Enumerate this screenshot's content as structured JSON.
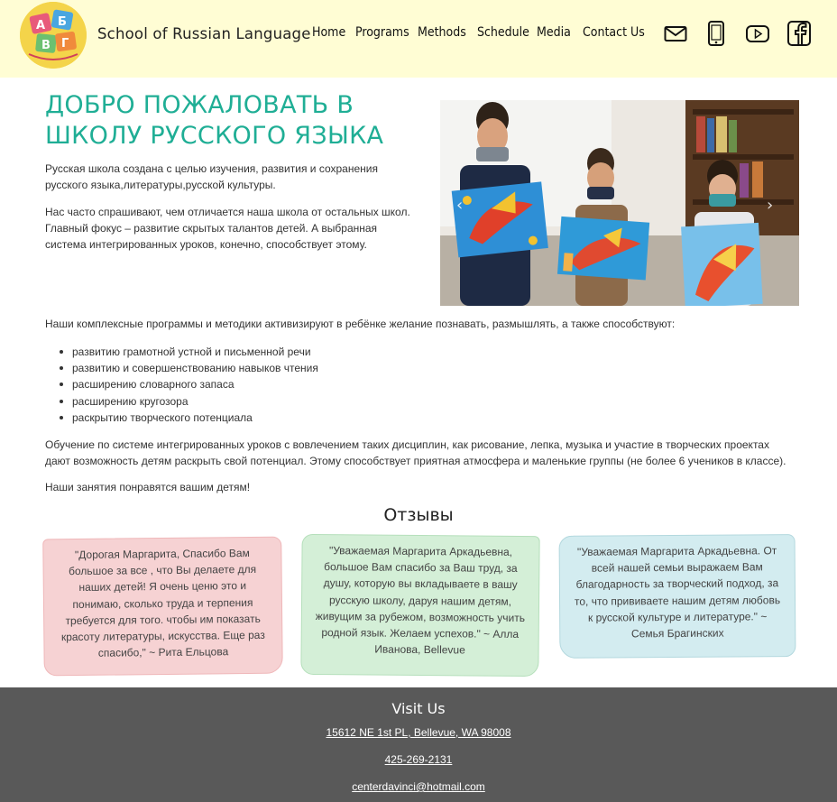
{
  "header": {
    "brand": "School of Russian Language",
    "nav": [
      "Home",
      "Programs",
      "Methods",
      "Schedule",
      "Media",
      "Contact Us"
    ],
    "icons": [
      "mail-icon",
      "phone-icon",
      "youtube-icon",
      "facebook-icon"
    ],
    "logo_letters": [
      "А",
      "Б",
      "В",
      "Г"
    ]
  },
  "main": {
    "title": "ДОБРО ПОЖАЛОВАТЬ В ШКОЛУ РУССКОГО ЯЗЫКА",
    "intro_1": "Русская школа создана с целью изучения, развития и сохранения русского языка,литературы,русской культуры.",
    "intro_2": "Нас часто спрашивают, чем отличается наша школа от остальных школ. Главный фокус – развитие скрытых талантов детей. А выбранная система интегрированных уроков, конечно, способствует этому.",
    "programs_lead": "Наши комплексные программы и методики активизируют в ребёнке желание познавать, размышлять, а также способствуют:",
    "bullets": [
      "развитию грамотной устной и письменной речи",
      "развитию и совершенствованию навыков чтения",
      "расширению словарного запаса",
      "расширению кругозора",
      "раскрытию творческого потенциала"
    ],
    "integrated": "Обучение по системе интегрированных уроков с вовлечением таких дисциплин, как рисование, лепка, музыка и участие в творческих проектах дают возможность детям раскрыть свой потенциал. Этому способствует приятная атмосфера и маленькие группы (не более 6 учеников в классе).",
    "closing": "Наши занятия понравятся вашим детям!",
    "carousel": {
      "prev": "‹",
      "next": "›"
    }
  },
  "reviews": {
    "title": "Отзывы",
    "items": [
      "\"Дорогая Маргарита, Спасибо Вам большое за все , что Вы делаете для наших детей! Я очень ценю это и понимаю, сколько труда и терпения требуется для того. чтобы им показать красоту литературы, искусства. Еще раз спасибо,\" ~ Рита Ельцова",
      "\"Уважаемая Маргарита Аркадьевна, большое Вам спасибо за Ваш труд, за душу, которую вы вкладываете в вашу русскую школу, даруя нашим детям, живущим за рубежом, возможность учить родной язык. Желаем успехов.\" ~ Алла Иванова, Bellevue",
      "\"Уважаемая Маргарита Аркадьевна. От всей нашей семьи выражаем Вам благодарность за творческий подход, за то, что прививаете нашим детям любовь к русской культуре и литературе.\" ~ Семья Брагинских"
    ]
  },
  "footer": {
    "title": "Visit Us",
    "address": "15612 NE 1st PL, Bellevue, WA 98008",
    "phone": "425-269-2131",
    "email": "centerdavinci@hotmail.com"
  },
  "colors": {
    "header_bg": "#fffdd4",
    "title_teal": "#1fae95",
    "footer_bg": "#595959",
    "card_pink": "#f6d2d3",
    "card_green": "#d4efd7",
    "card_blue": "#d3ecf0"
  }
}
